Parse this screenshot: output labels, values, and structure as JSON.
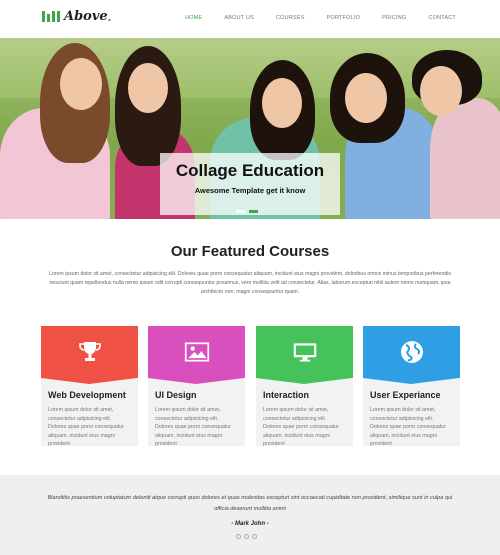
{
  "brand": {
    "name": "Above",
    "accent": "#3fa64a"
  },
  "nav": {
    "items": [
      {
        "label": "HOME",
        "active": true
      },
      {
        "label": "ABOUT US",
        "active": false
      },
      {
        "label": "COURSES",
        "active": false
      },
      {
        "label": "PORTFOLIO",
        "active": false
      },
      {
        "label": "PRICING",
        "active": false
      },
      {
        "label": "CONTACT",
        "active": false
      }
    ]
  },
  "hero": {
    "title": "Collage Education",
    "subtitle": "Awesome Template get it know",
    "slides": 2,
    "active_slide": 1
  },
  "featured": {
    "title": "Our Featured Courses",
    "description": "Lorem ipsum dolor sit amet, consectetur adipisicing elit. Dolores quae porro consequatur aliquam, incidunt eius magni provident, doloribus omnis minus temporibus perferendis nesciunt quam repellendus nulla nemo ipsum odit corrupti consequuntur possimus, vero mollitia velit ad consectetur. Alias, laborum excepturi nihil autem nemo numquam, ipsa architecto non, magni consequuntur quam."
  },
  "cards": [
    {
      "title": "Web Development",
      "color": "#ef5245",
      "icon": "trophy-icon",
      "text": "Lorem ipsum dolor sit amet, consectetur adipisicing elit. Dolores quae porro consequatur aliquam, incidunt eius magni provident"
    },
    {
      "title": "UI Design",
      "color": "#d94fbd",
      "icon": "image-icon",
      "text": "Lorem ipsum dolor sit amet, consectetur adipisicing elit. Dolores quae porro consequatur aliquam, incidunt eius magni provident"
    },
    {
      "title": "Interaction",
      "color": "#45c25a",
      "icon": "monitor-icon",
      "text": "Lorem ipsum dolor sit amet, consectetur adipisicing elit. Dolores quae porro consequatur aliquam, incidunt eius magni provident"
    },
    {
      "title": "User Experiance",
      "color": "#2e9fe4",
      "icon": "globe-icon",
      "text": "Lorem ipsum dolor sit amet, consectetur adipisicing elit. Dolores quae porro consequatur aliquam, incidunt eius magni provident"
    }
  ],
  "testimonial": {
    "quote": "Blanditiis praesentium voluptatum deleniti atque corrupti quos dolores et quas molestias excepturi sint occaecati cupiditate non provident, similique sunt in culpa qui officia deserunt mollitia animi",
    "author": "- Mark John -",
    "dots": 3
  }
}
